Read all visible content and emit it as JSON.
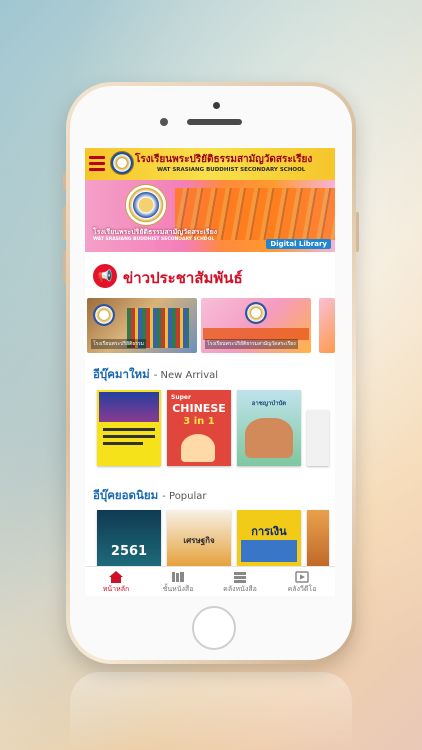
{
  "app": {
    "school_name_th": "โรงเรียนพระปริยัติธรรมสามัญวัดสระเรียง",
    "school_name_en": "WAT SRASIANG BUDDHIST SECONDARY SCHOOL",
    "banner_tag": "Digital Library"
  },
  "news": {
    "title": "ข่าวประชาสัมพันธ์",
    "cards": [
      {
        "caption": "โรงเรียนพระปริยัติธรรม"
      },
      {
        "caption": "โรงเรียนพระปริยัติธรรมสามัญวัดสระเรียง"
      }
    ]
  },
  "new_arrival": {
    "title_th": "อีบุ๊คมาใหม่",
    "title_en": "New Arrival",
    "books": [
      {
        "title": "",
        "color": "#1f3a8a"
      },
      {
        "title": "CHINESE",
        "badge": "Super",
        "sub": "3 in 1",
        "color": "#e0463b"
      },
      {
        "title": "อาชญาบำบัด",
        "color": "#4aa6b8"
      }
    ]
  },
  "popular": {
    "title_th": "อีบุ๊คยอดนิยม",
    "title_en": "Popular",
    "books": [
      {
        "title": "2561",
        "color": "#133f5c"
      },
      {
        "title": "เศรษฐกิจ",
        "color": "#e08c2b"
      },
      {
        "title": "การเงิน",
        "color": "#f1cb18"
      }
    ]
  },
  "tabs": [
    {
      "label": "หน้าหลัก",
      "icon": "home-icon",
      "active": true
    },
    {
      "label": "ชั้นหนังสือ",
      "icon": "bookshelf-icon",
      "active": false
    },
    {
      "label": "คลังหนังสือ",
      "icon": "library-icon",
      "active": false
    },
    {
      "label": "คลังวีดีโอ",
      "icon": "video-icon",
      "active": false
    }
  ],
  "colors": {
    "accent_red": "#d10f26",
    "section_blue": "#1b6ab0",
    "topbar_yellow": "#f9e04b"
  }
}
